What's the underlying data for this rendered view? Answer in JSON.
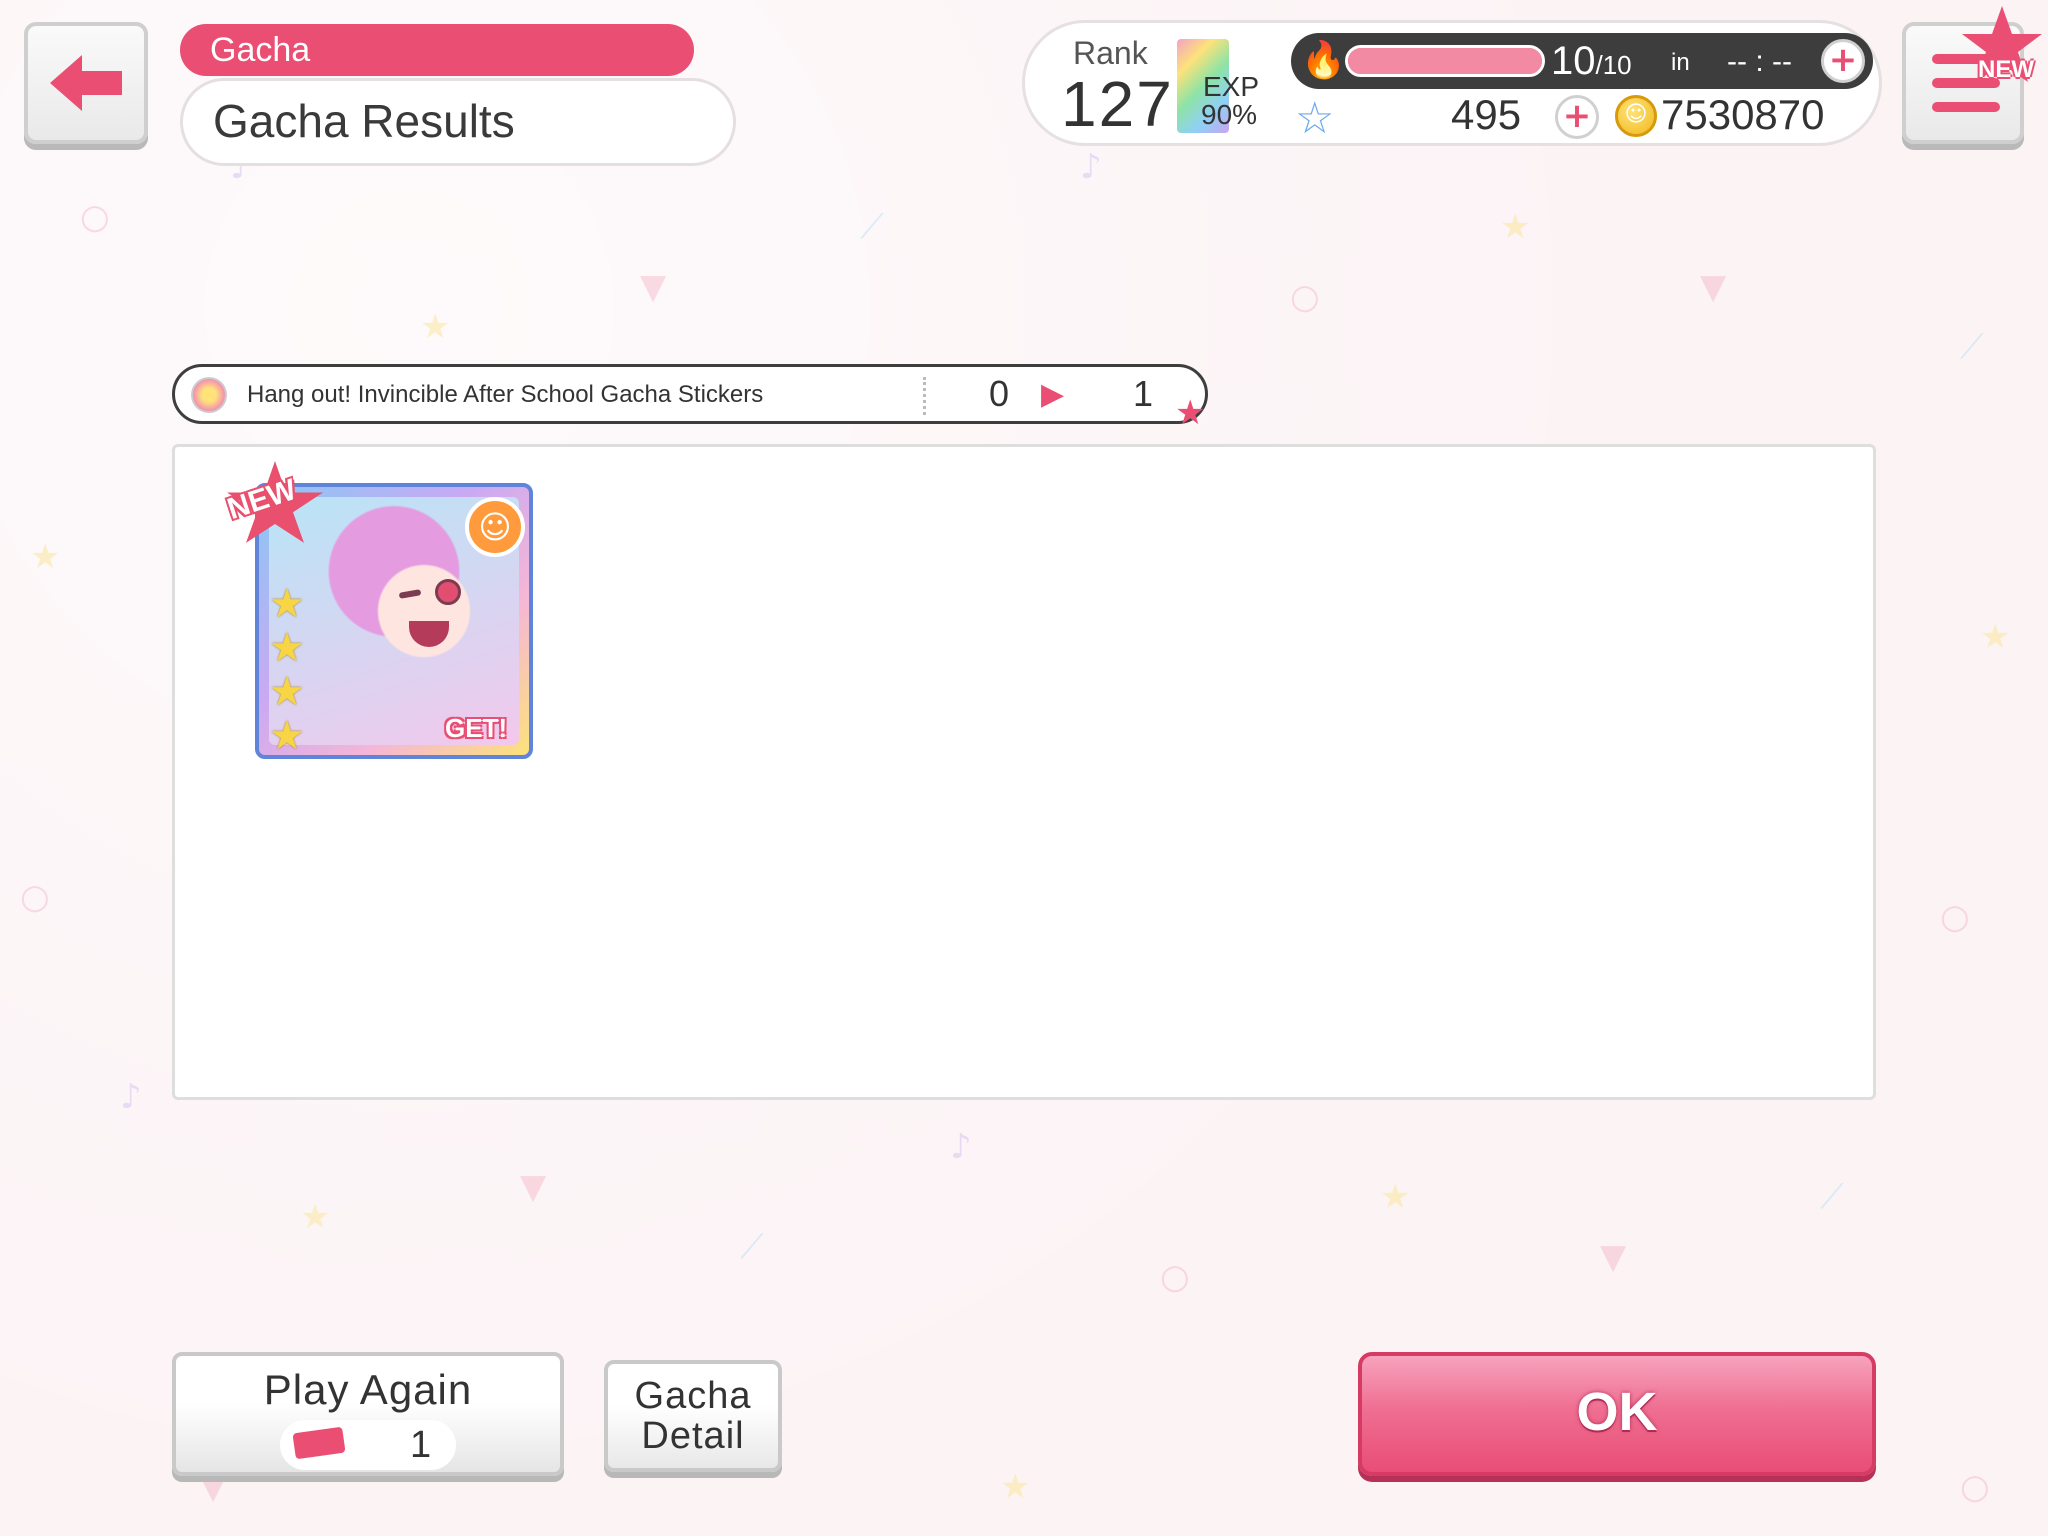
{
  "header": {
    "breadcrumb": "Gacha",
    "title": "Gacha Results"
  },
  "status": {
    "rank_label": "Rank",
    "rank_value": "127",
    "exp_label": "EXP",
    "exp_value": "90%",
    "stamina_current": "10",
    "stamina_max": "/10",
    "stamina_in": "in",
    "stamina_timer": "-- : --",
    "stamina_fraction": 1.0,
    "gems": "495",
    "coins": "7530870"
  },
  "menu": {
    "badge": "NEW"
  },
  "stickers": {
    "name": "Hang out! Invincible After School Gacha Stickers",
    "from": "0",
    "to": "1"
  },
  "results": {
    "cards": [
      {
        "badge": "NEW",
        "get_label": "GET!",
        "rarity_stars": 4,
        "attribute": "happy",
        "attribute_color": "#ff9b3c"
      }
    ]
  },
  "buttons": {
    "play_again": "Play Again",
    "play_again_cost": "1",
    "gacha_detail_line1": "Gacha",
    "gacha_detail_line2": "Detail",
    "ok": "OK"
  },
  "colors": {
    "accent": "#ea4f73",
    "background": "#fcf3f5"
  },
  "icons": [
    "back-arrow-icon",
    "menu-icon",
    "flame-icon",
    "star-gem-icon",
    "coin-icon",
    "plus-icon",
    "sticker-icon",
    "ticket-icon"
  ]
}
